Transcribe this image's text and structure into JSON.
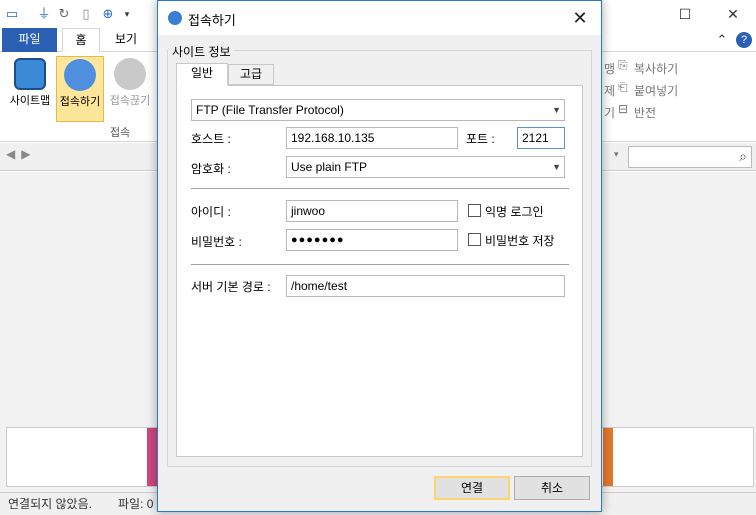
{
  "app": {
    "tabs": {
      "file": "파일",
      "home": "홈",
      "view": "보기"
    },
    "ribbon": {
      "sitemap": "사이트맵",
      "connect": "접속하기",
      "disconnect": "접속끊기",
      "group_label": "접속",
      "copy": "복사하기",
      "paste": "붙여넣기",
      "invert": "반전",
      "partial1": "맹",
      "partial2": "제",
      "partial3": "기"
    },
    "status": {
      "text": "연결되지 않았음.",
      "file_prefix": "파일: 0"
    },
    "colors": {
      "file_tab": "#2b5fb3",
      "transfer_bar_1": "#d0467d",
      "transfer_bar_2": "#e0782d"
    }
  },
  "dialog": {
    "title": "접속하기",
    "group_title": "사이트 정보",
    "tabs": {
      "general": "일반",
      "advanced": "고급"
    },
    "protocol": "FTP (File Transfer Protocol)",
    "host_label": "호스트 :",
    "host_value": "192.168.10.135",
    "port_label": "포트 :",
    "port_value": "2121",
    "encryption_label": "암호화 :",
    "encryption_value": "Use plain FTP",
    "id_label": "아이디 :",
    "id_value": "jinwoo",
    "anon_label": "익명 로그인",
    "password_label": "비밀번호 :",
    "password_value": "●●●●●●●",
    "save_password_label": "비밀번호 저장",
    "path_label": "서버 기본 경로 :",
    "path_value": "/home/test",
    "ok": "연결",
    "cancel": "취소"
  }
}
